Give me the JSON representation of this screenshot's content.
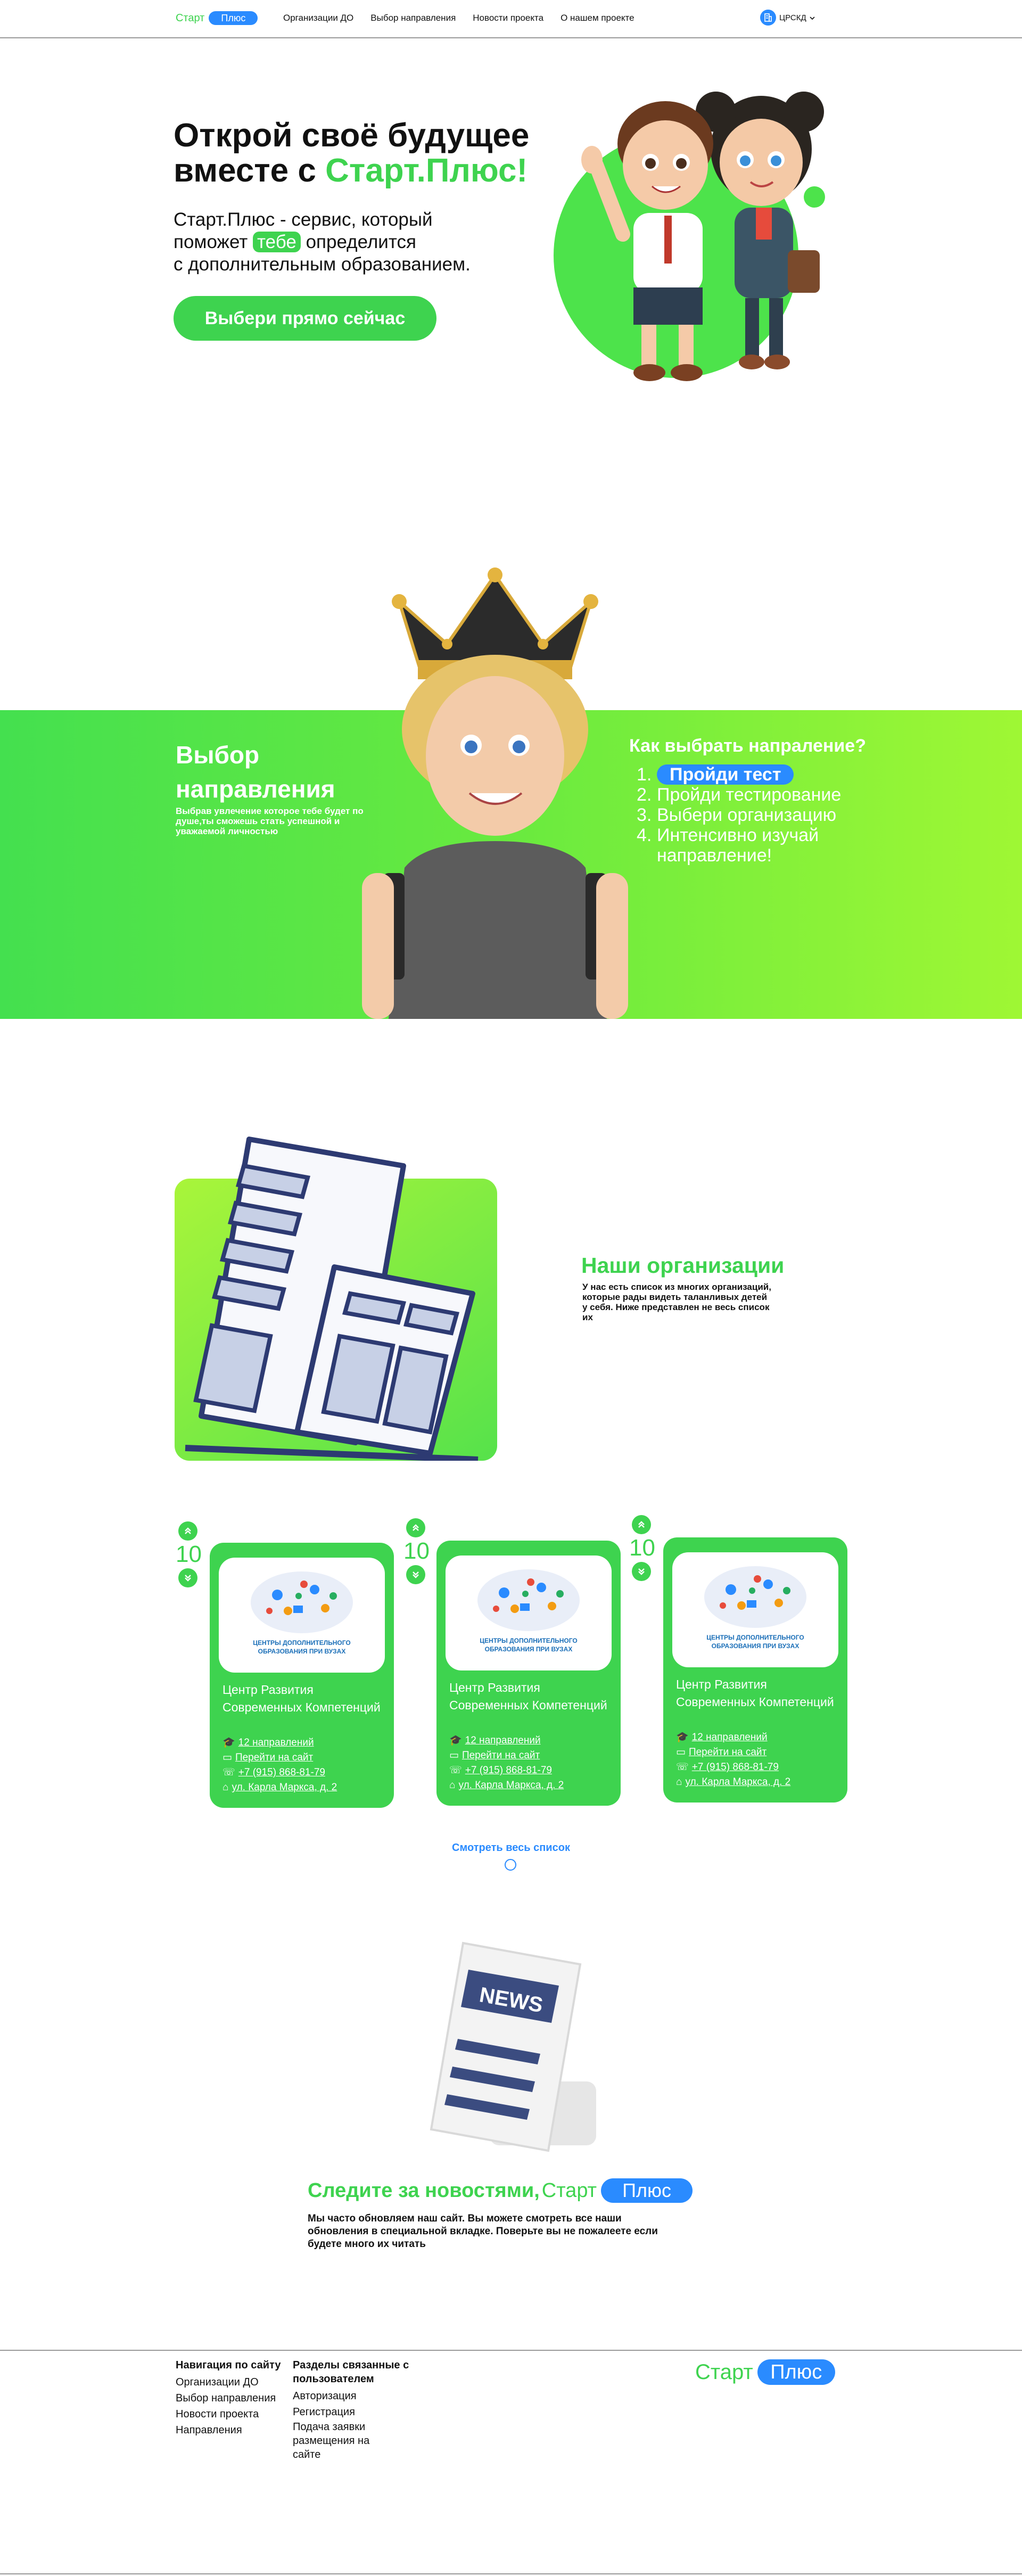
{
  "brand": {
    "word": "Старт",
    "pill": "Плюс"
  },
  "nav": [
    "Организации ДО",
    "Выбор направления",
    "Новости проекта",
    "О нашем проекте"
  ],
  "user": {
    "name": "ЦРСКД"
  },
  "hero": {
    "title_1": "Открой своё будущее",
    "title_2a": "вместе с ",
    "title_2b": "Старт.Плюс!",
    "text_1": "Старт.Плюс - сервис, который",
    "text_2a": "поможет ",
    "text_2b": "тебе",
    "text_2c": " определится",
    "text_3": "с дополнительным образованием.",
    "cta": "Выбери прямо сейчас"
  },
  "choice": {
    "title": "Выбор направления",
    "subtitle": "Выбрав увлечение которое тебе будет по душе,ты сможешь стать успешной и уважаемой личностью",
    "steps_title": "Как выбрать напраление?",
    "steps": [
      "Пройди тест",
      "Пройди тестирование",
      "Выбери организацию",
      "Интенсивно изучай направление!"
    ]
  },
  "orgs": {
    "title": "Наши организации",
    "text": "У нас есть список из многих организаций, которые рады видеть таланливых детей у себя. Ниже представлен не весь список их",
    "cards": [
      {
        "votes": "10",
        "logo_text": "ЦЕНТРЫ ДОПОЛНИТЕЛЬНОГО ОБРАЗОВАНИЯ ПРИ ВУЗАХ",
        "name": "Центр Развития Современных Компетенций",
        "directions": "12 направлений",
        "site": "Перейти на сайт",
        "phone": "+7 (915) 868-81-79",
        "address": "ул. Карла Маркса, д. 2"
      },
      {
        "votes": "10",
        "logo_text": "ЦЕНТРЫ ДОПОЛНИТЕЛЬНОГО ОБРАЗОВАНИЯ ПРИ ВУЗАХ",
        "name": "Центр Развития Современных Компетенций",
        "directions": "12 направлений",
        "site": "Перейти на сайт",
        "phone": "+7 (915) 868-81-79",
        "address": "ул. Карла Маркса, д. 2"
      },
      {
        "votes": "10",
        "logo_text": "ЦЕНТРЫ ДОПОЛНИТЕЛЬНОГО ОБРАЗОВАНИЯ ПРИ ВУЗАХ",
        "name": "Центр Развития Современных Компетенций",
        "directions": "12 направлений",
        "site": "Перейти на сайт",
        "phone": "+7 (915) 868-81-79",
        "address": "ул. Карла Маркса, д. 2"
      }
    ],
    "see_all": "Смотреть весь список"
  },
  "news": {
    "badge": "NEWS",
    "title_a": "Следите за новостями,",
    "title_b": "Старт",
    "title_pill": "Плюс",
    "text": "Мы часто обновляем наш сайт. Вы можете смотреть все наши обновления в специальной вкладке. Поверьте вы не пожалеете если будете много их читать"
  },
  "footer": {
    "col1_title": "Навигация по сайту",
    "col1": [
      "Организации ДО",
      "Выбор направления",
      "Новости проекта",
      "Направления"
    ],
    "col2_title": "Разделы связанные с пользователем",
    "col2": [
      "Авторизация",
      "Регистрация",
      "Подача заявки размещения на сайте"
    ]
  },
  "colors": {
    "green": "#3ed34f",
    "blue": "#2a8bff",
    "navy": "#2d3a72"
  }
}
